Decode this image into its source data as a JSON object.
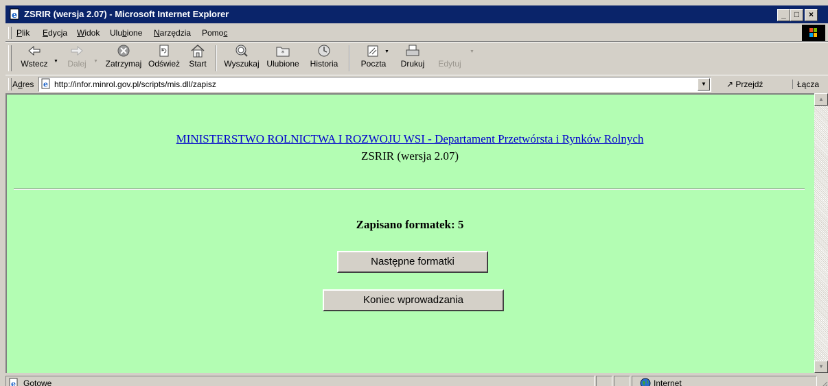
{
  "window": {
    "title": "ZSRIR (wersja 2.07) - Microsoft Internet Explorer",
    "controls": {
      "minimize": "_",
      "maximize": "□",
      "close": "×"
    }
  },
  "menubar": [
    {
      "prefix": "",
      "u": "P",
      "rest": "lik"
    },
    {
      "prefix": "",
      "u": "E",
      "rest": "dycja"
    },
    {
      "prefix": "",
      "u": "W",
      "rest": "idok"
    },
    {
      "prefix": "Ulu",
      "u": "b",
      "rest": "ione"
    },
    {
      "prefix": "",
      "u": "N",
      "rest": "arzędzia"
    },
    {
      "prefix": "Pomo",
      "u": "c",
      "rest": ""
    }
  ],
  "toolbar": [
    {
      "label": "Wstecz",
      "icon": "back-arrow-icon",
      "enabled": true
    },
    {
      "label": "Dalej",
      "icon": "forward-arrow-icon",
      "enabled": false
    },
    {
      "label": "Zatrzymaj",
      "icon": "stop-icon",
      "enabled": true
    },
    {
      "label": "Odśwież",
      "icon": "refresh-icon",
      "enabled": true
    },
    {
      "label": "Start",
      "icon": "home-icon",
      "enabled": true
    },
    {
      "label": "Wyszukaj",
      "icon": "search-icon",
      "enabled": true
    },
    {
      "label": "Ulubione",
      "icon": "favorites-icon",
      "enabled": true
    },
    {
      "label": "Historia",
      "icon": "history-icon",
      "enabled": true
    },
    {
      "label": "Poczta",
      "icon": "mail-icon",
      "enabled": true
    },
    {
      "label": "Drukuj",
      "icon": "print-icon",
      "enabled": true
    },
    {
      "label": "Edytuj",
      "icon": "edit-icon",
      "enabled": false
    }
  ],
  "address": {
    "label_prefix": "A",
    "label_u": "d",
    "label_rest": "res",
    "url": "http://infor.minrol.gov.pl/scripts/mis.dll/zapisz",
    "go_label": "Przejdź",
    "links_label": "Łącza"
  },
  "page": {
    "ministry_link": "MINISTERSTWO ROLNICTWA I ROZWOJU WSI - Departament Przetwórsta i Rynków Rolnych",
    "app_version": "ZSRIR (wersja 2.07)",
    "saved_message": "Zapisano formatek: 5",
    "next_button": "Następne formatki",
    "finish_button": "Koniec wprowadzania"
  },
  "statusbar": {
    "status": "Gotowe",
    "zone": "Internet"
  },
  "colors": {
    "titlebar": "#0a246a",
    "page_background": "#b3fdb3",
    "link": "#0000cc",
    "chrome": "#d4d0c8"
  }
}
